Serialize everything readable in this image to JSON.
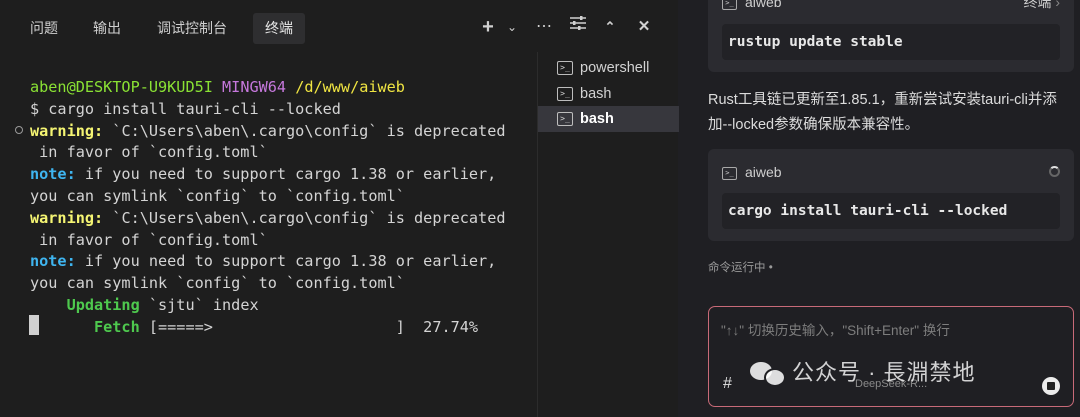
{
  "tabs": {
    "problems": "问题",
    "output": "输出",
    "debug_console": "调试控制台",
    "terminal": "终端"
  },
  "toolbar_icons": [
    "plus-icon",
    "chevron-down-icon",
    "more-icon",
    "settings-sliders-icon",
    "chevron-up-icon",
    "close-icon"
  ],
  "terminal": {
    "prompt_user": "aben@DESKTOP-U9KUD5I",
    "prompt_env": "MINGW64",
    "prompt_path": "/d/www/aiweb",
    "command_line": "$ cargo install tauri-cli --locked",
    "warning_label": "warning:",
    "warning_text_1": " `C:\\Users\\aben\\.cargo\\config` is deprecated",
    "warning_text_2": " in favor of `config.toml`",
    "note_label": "note:",
    "note_text_1": " if you need to support cargo 1.38 or earlier,",
    "note_text_2": "you can symlink `config` to `config.toml`",
    "updating_label": "    Updating",
    "updating_text": " `sjtu` index",
    "fetch_label": "       Fetch",
    "fetch_text": " [=====>                    ]  27.74%",
    "fetch_progress": 0.2774
  },
  "terminal_list": [
    {
      "label": "powershell"
    },
    {
      "label": "bash"
    },
    {
      "label": "bash"
    }
  ],
  "chat": {
    "card1": {
      "name": "aiweb",
      "right_label": "终端",
      "command": "rustup update stable"
    },
    "message": "Rust工具链已更新至1.85.1，重新尝试安装tauri-cli并添加--locked参数确保版本兼容性。",
    "card2": {
      "name": "aiweb",
      "command": "cargo install tauri-cli --locked"
    },
    "status": "命令运行中 •",
    "input_placeholder": "\"↑↓\" 切换历史输入，\"Shift+Enter\" 换行",
    "hash_symbol": "#",
    "model_hint": "DeepSeek-R..."
  },
  "watermark": "公众号 · 長淵禁地"
}
